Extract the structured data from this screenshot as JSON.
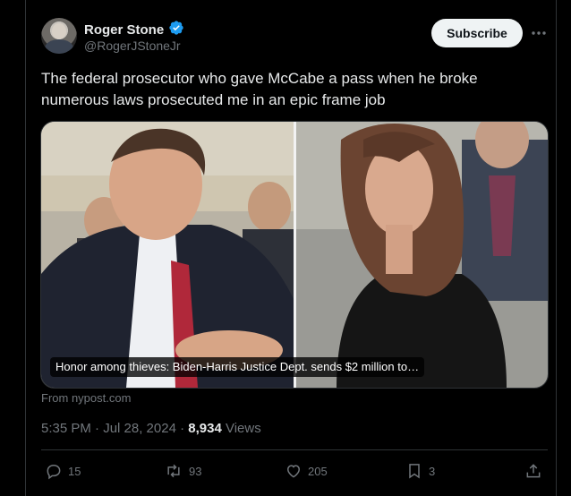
{
  "author": {
    "name": "Roger Stone",
    "handle": "@RogerJStoneJr",
    "verified": true
  },
  "subscribe_label": "Subscribe",
  "tweet": {
    "text": "The federal prosecutor who gave McCabe a pass when he broke numerous laws prosecuted me in an epic frame job"
  },
  "media": {
    "caption": "Honor among thieves: Biden-Harris Justice Dept. sends $2 million to…",
    "source": "From nypost.com"
  },
  "meta": {
    "time": "5:35 PM · Jul 28, 2024 · ",
    "views_count": "8,934",
    "views_label": " Views"
  },
  "actions": {
    "replies": "15",
    "reposts": "93",
    "likes": "205",
    "bookmarks": "3"
  },
  "colors": {
    "background": "#000000",
    "text": "#e7e9ea",
    "secondary": "#71767b",
    "verified": "#1d9bf0",
    "subscribe_bg": "#eff3f4"
  }
}
